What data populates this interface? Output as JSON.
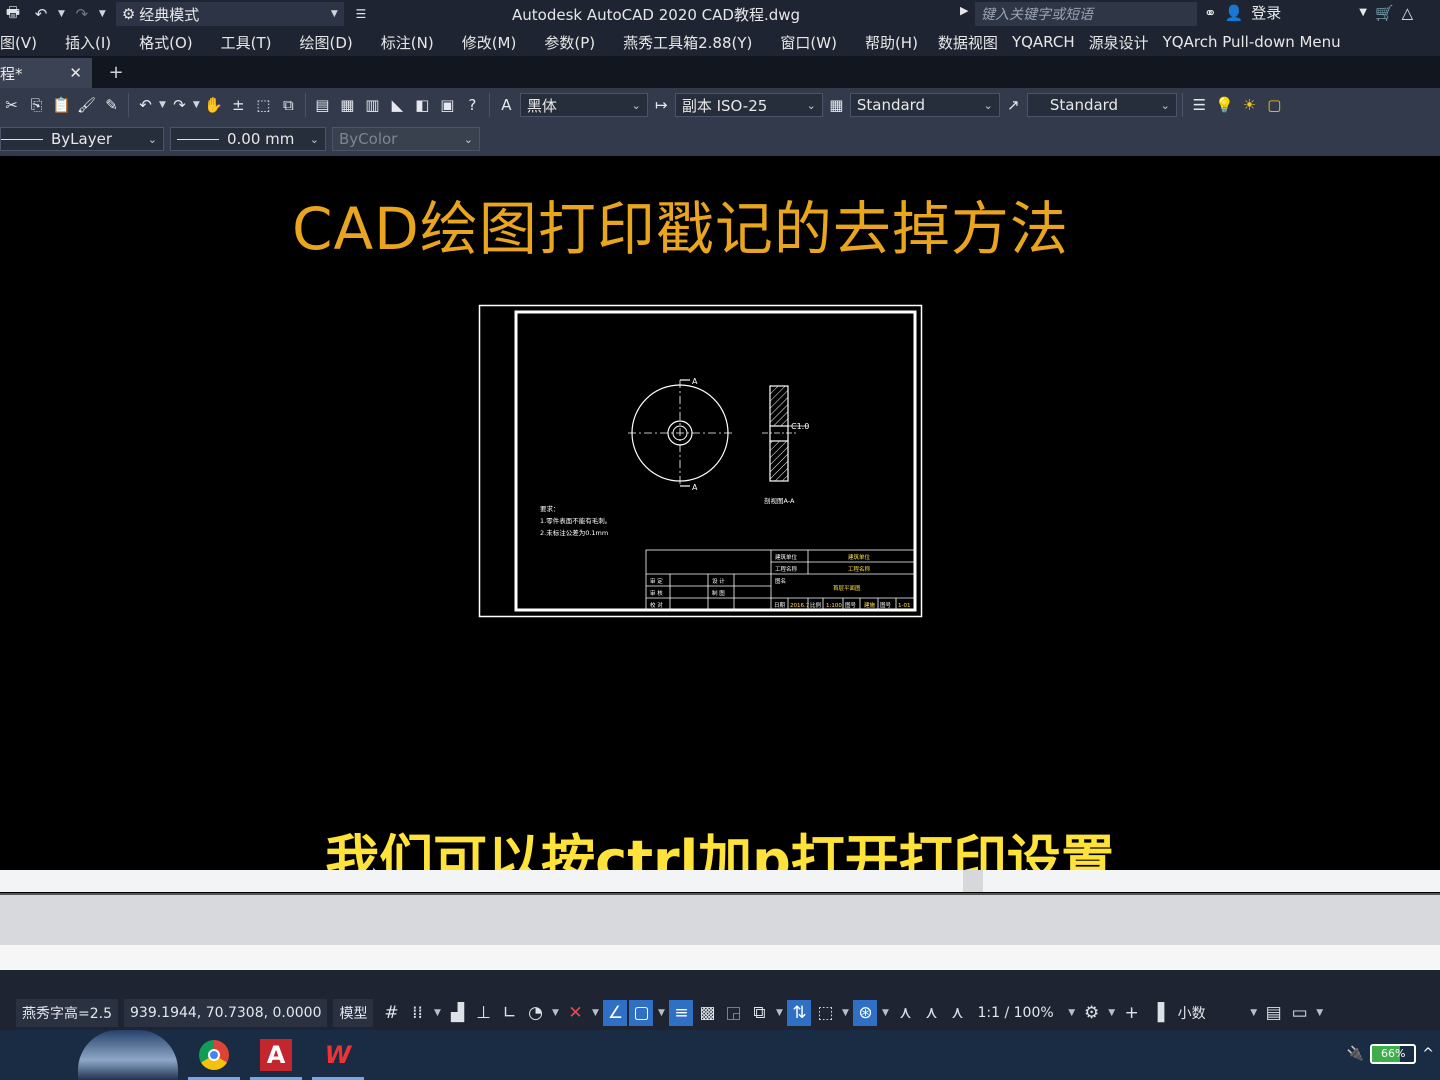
{
  "titlebar": {
    "workspace": "经典模式",
    "app_title": "Autodesk AutoCAD 2020    CAD教程.dwg",
    "search_placeholder": "键入关键字或短语",
    "login": "登录"
  },
  "menu": [
    "图(V)",
    "插入(I)",
    "格式(O)",
    "工具(T)",
    "绘图(D)",
    "标注(N)",
    "修改(M)",
    "参数(P)",
    "燕秀工具箱2.88(Y)",
    "窗口(W)",
    "帮助(H)",
    "数据视图",
    "YQARCH",
    "源泉设计",
    "YQArch Pull-down Menu"
  ],
  "tab": {
    "label": "程*",
    "close": "✕",
    "add": "+"
  },
  "toolbar1": {
    "text_style": "黑体",
    "dim_style": "副本 ISO-25",
    "table_style": "Standard",
    "multileader_style": "Standard"
  },
  "toolbar2": {
    "linetype": "ByLayer",
    "lineweight": "0.00 mm",
    "plotstyle": "ByColor"
  },
  "canvas": {
    "heading": "CAD绘图打印戳记的去掉方法",
    "subtitle": "我们可以按ctrl加p打开打印设置"
  },
  "drawing": {
    "section_mark": "A",
    "chamfer": "C1.0",
    "section_label": "剖视图A-A",
    "notes_title": "要求：",
    "note1": "1.零件表面不能有毛刺。",
    "note2": "2.未标注公差为0.1mm",
    "title_block": {
      "r1a": "建筑单位",
      "r1b": "建筑单位",
      "r2a": "工程名称",
      "r2b": "工程名称",
      "r3a": "图名",
      "r3b": "首层平面图",
      "left_rows": [
        [
          "审  定",
          "设  计"
        ],
        [
          "审  核",
          "制  图"
        ],
        [
          "校  对",
          ""
        ]
      ],
      "bottom": [
        "日期",
        "2016.7",
        "比例",
        "1:100",
        "图号",
        "建施",
        "图号",
        "1-01"
      ]
    }
  },
  "statusbar": {
    "font_height": "燕秀字高=2.5",
    "coords": "939.1944, 70.7308, 0.0000",
    "model": "模型",
    "scale": "1:1 / 100%",
    "units": "小数"
  },
  "taskbar": {
    "battery_percent": "66%",
    "battery_level": 0.66
  }
}
